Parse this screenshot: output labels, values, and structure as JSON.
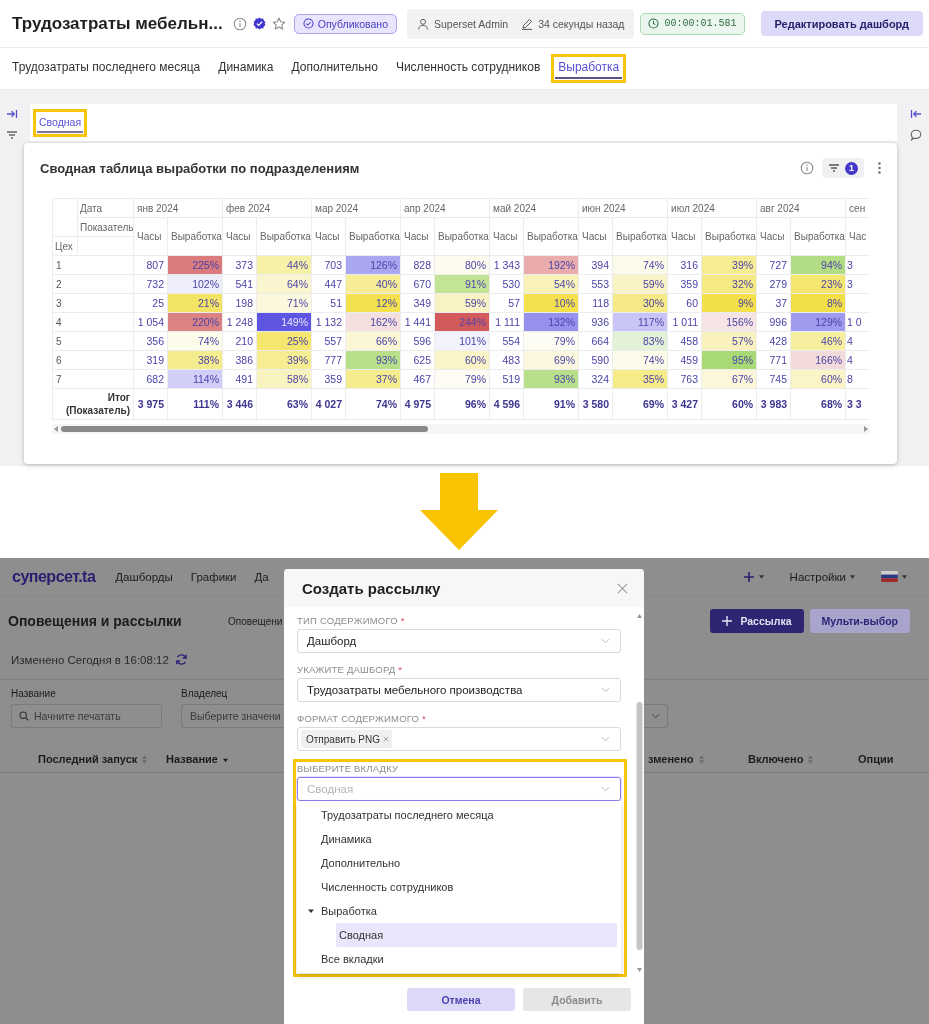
{
  "dashboard_screen": {
    "header": {
      "title": "Трудозатраты мебельн...",
      "favorite": false,
      "status": "Опубликовано",
      "owner": "Superset Admin",
      "modified": "34 секунды назад",
      "timer": "00:00:01.581",
      "edit_button": "Редактировать дашборд"
    },
    "tabs": [
      {
        "label": "Трудозатраты последнего месяца",
        "selected": false,
        "highlighted": false
      },
      {
        "label": "Динамика",
        "selected": false,
        "highlighted": false
      },
      {
        "label": "Дополнительно",
        "selected": false,
        "highlighted": false
      },
      {
        "label": "Численность сотрудников",
        "selected": false,
        "highlighted": false
      },
      {
        "label": "Выработка",
        "selected": true,
        "highlighted": true
      }
    ],
    "subtabs": [
      {
        "label": "Сводная",
        "selected": true,
        "highlighted": true
      }
    ],
    "chart": {
      "title": "Сводная таблица выработки по подразделениям",
      "filter_count": "1",
      "pivot": {
        "column_field": "Дата",
        "measure_field": "Показатель",
        "row_field": "Цех",
        "months": [
          {
            "label": "янв 2024",
            "measures": [
              "Часы",
              "Выработка"
            ]
          },
          {
            "label": "фев 2024",
            "measures": [
              "Часы",
              "Выработка"
            ]
          },
          {
            "label": "мар 2024",
            "measures": [
              "Часы",
              "Выработка"
            ]
          },
          {
            "label": "апр 2024",
            "measures": [
              "Часы",
              "Выработка"
            ]
          },
          {
            "label": "май 2024",
            "measures": [
              "Часы",
              "Выработка"
            ]
          },
          {
            "label": "июн 2024",
            "measures": [
              "Часы",
              "Выработка"
            ]
          },
          {
            "label": "июл 2024",
            "measures": [
              "Часы",
              "Выработка"
            ]
          },
          {
            "label": "авг 2024",
            "measures": [
              "Часы",
              "Выработка"
            ]
          },
          {
            "label": "сен",
            "measures": [
              "Час"
            ]
          }
        ],
        "rows": [
          {
            "label": "1",
            "cells": [
              {
                "hours": "807",
                "output": "225%",
                "color": "#da7c7d"
              },
              {
                "hours": "373",
                "output": "44%",
                "color": "#f7f0a7"
              },
              {
                "hours": "703",
                "output": "126%",
                "color": "#aaa7f1"
              },
              {
                "hours": "828",
                "output": "80%",
                "color": "#fdfbee"
              },
              {
                "hours": "1 343",
                "output": "192%",
                "color": "#e9abac"
              },
              {
                "hours": "394",
                "output": "74%",
                "color": "#fcfae8"
              },
              {
                "hours": "316",
                "output": "39%",
                "color": "#f6ec92"
              },
              {
                "hours": "727",
                "output": "94%",
                "color": "#b3dd84"
              },
              {
                "hours": "3"
              }
            ]
          },
          {
            "label": "2",
            "cells": [
              {
                "hours": "732",
                "output": "102%",
                "color": "#eeeefb"
              },
              {
                "hours": "541",
                "output": "64%",
                "color": "#faf5cf"
              },
              {
                "hours": "447",
                "output": "40%",
                "color": "#f6ed96"
              },
              {
                "hours": "670",
                "output": "91%",
                "color": "#c3e497"
              },
              {
                "hours": "530",
                "output": "54%",
                "color": "#f8f2b8"
              },
              {
                "hours": "553",
                "output": "59%",
                "color": "#f9f3c3"
              },
              {
                "hours": "359",
                "output": "32%",
                "color": "#f5e983"
              },
              {
                "hours": "279",
                "output": "23%",
                "color": "#f4e66f"
              },
              {
                "hours": "3"
              }
            ]
          },
          {
            "label": "3",
            "cells": [
              {
                "hours": "25",
                "output": "21%",
                "color": "#f4e465"
              },
              {
                "hours": "198",
                "output": "71%",
                "color": "#fcf8de"
              },
              {
                "hours": "51",
                "output": "12%",
                "color": "#f3e150"
              },
              {
                "hours": "349",
                "output": "59%",
                "color": "#f9f3c3"
              },
              {
                "hours": "57",
                "output": "10%",
                "color": "#f3e04c"
              },
              {
                "hours": "118",
                "output": "30%",
                "color": "#f5ea86"
              },
              {
                "hours": "60",
                "output": "9%",
                "color": "#f3df49"
              },
              {
                "hours": "37",
                "output": "8%",
                "color": "#f3df47"
              }
            ]
          },
          {
            "label": "4",
            "cells": [
              {
                "hours": "1 054",
                "output": "220%",
                "color": "#db8384"
              },
              {
                "hours": "1 248",
                "output": "149%",
                "color": "#5e56e0"
              },
              {
                "hours": "1 132",
                "output": "162%",
                "color": "#f4dfdf"
              },
              {
                "hours": "1 441",
                "output": "244%",
                "color": "#d45b5b"
              },
              {
                "hours": "1 111",
                "output": "132%",
                "color": "#9591ec"
              },
              {
                "hours": "936",
                "output": "117%",
                "color": "#c8c5f6"
              },
              {
                "hours": "1 011",
                "output": "156%",
                "color": "#f6e4e4"
              },
              {
                "hours": "996",
                "output": "129%",
                "color": "#9f9bee"
              },
              {
                "hours": "1 0"
              }
            ]
          },
          {
            "label": "5",
            "cells": [
              {
                "hours": "356",
                "output": "74%",
                "color": "#fdfbea"
              },
              {
                "hours": "210",
                "output": "25%",
                "color": "#f4e66f"
              },
              {
                "hours": "557",
                "output": "66%",
                "color": "#fbf6d4"
              },
              {
                "hours": "596",
                "output": "101%",
                "color": "#f2f2fc"
              },
              {
                "hours": "554",
                "output": "79%",
                "color": "#fefdf4"
              },
              {
                "hours": "664",
                "output": "83%",
                "color": "#e3f2d6"
              },
              {
                "hours": "458",
                "output": "57%",
                "color": "#f9f2be"
              },
              {
                "hours": "428",
                "output": "46%",
                "color": "#f7efa0"
              },
              {
                "hours": "4"
              }
            ]
          },
          {
            "label": "6",
            "cells": [
              {
                "hours": "319",
                "output": "38%",
                "color": "#f5ec8d"
              },
              {
                "hours": "386",
                "output": "39%",
                "color": "#f6ed92"
              },
              {
                "hours": "777",
                "output": "93%",
                "color": "#b8e08b"
              },
              {
                "hours": "625",
                "output": "60%",
                "color": "#faf4c6"
              },
              {
                "hours": "483",
                "output": "69%",
                "color": "#fcf8e0"
              },
              {
                "hours": "590",
                "output": "74%",
                "color": "#fdfbea"
              },
              {
                "hours": "459",
                "output": "95%",
                "color": "#a8d974"
              },
              {
                "hours": "771",
                "output": "166%",
                "color": "#f3dadb"
              },
              {
                "hours": "4"
              }
            ]
          },
          {
            "label": "7",
            "cells": [
              {
                "hours": "682",
                "output": "114%",
                "color": "#d1cef8"
              },
              {
                "hours": "491",
                "output": "58%",
                "color": "#f9f3c0"
              },
              {
                "hours": "359",
                "output": "37%",
                "color": "#f5ec8e"
              },
              {
                "hours": "467",
                "output": "79%",
                "color": "#fefcf2"
              },
              {
                "hours": "519",
                "output": "93%",
                "color": "#b8e08b"
              },
              {
                "hours": "324",
                "output": "35%",
                "color": "#f5eb88"
              },
              {
                "hours": "763",
                "output": "67%",
                "color": "#fcf7da"
              },
              {
                "hours": "745",
                "output": "60%",
                "color": "#faf4c6"
              },
              {
                "hours": "8"
              }
            ]
          }
        ],
        "total": {
          "label": "Итог (Показатель)",
          "cells": [
            {
              "hours": "3 975",
              "output": "111%"
            },
            {
              "hours": "3 446",
              "output": "63%"
            },
            {
              "hours": "4 027",
              "output": "74%"
            },
            {
              "hours": "4 975",
              "output": "96%"
            },
            {
              "hours": "4 596",
              "output": "91%"
            },
            {
              "hours": "3 580",
              "output": "69%"
            },
            {
              "hours": "3 427",
              "output": "60%"
            },
            {
              "hours": "3 983",
              "output": "68%"
            },
            {
              "hours": "3 3"
            }
          ]
        }
      }
    }
  },
  "mailing_screen": {
    "nav": {
      "logo": "суперсет.ta",
      "items": [
        "Дашборды",
        "Графики",
        "Да"
      ],
      "settings": "Настройки"
    },
    "title": "Оповещения и рассылки",
    "view_tab": "Оповещени",
    "actions": [
      {
        "label": "Рассылка",
        "kind": "primary"
      },
      {
        "label": "Мульти-выбор",
        "kind": "secondary"
      }
    ],
    "last_modified": "Изменено Сегодня в 16:08:12",
    "filters": [
      {
        "kind": "search",
        "label": "Название",
        "placeholder": "Начните печатать"
      },
      {
        "kind": "select",
        "label": "Владелец",
        "placeholder": "Выберите значени"
      }
    ],
    "columns_left": [
      {
        "label": "Последний запуск",
        "sortable": true,
        "sorted": false
      },
      {
        "label": "Название",
        "sortable": true,
        "sorted": true
      }
    ],
    "columns_right": [
      {
        "label": "зменено",
        "sortable": true,
        "sorted": false
      },
      {
        "label": "Включено",
        "sortable": true,
        "sorted": false
      },
      {
        "label": "Опции",
        "sortable": false
      }
    ],
    "modal": {
      "title": "Создать рассылку",
      "fields": [
        {
          "kind": "select",
          "label": "ТИП СОДЕРЖИМОГО",
          "required_mark": "*",
          "value": "Дашборд",
          "highlighted": false
        },
        {
          "kind": "select",
          "label": "УКАЖИТЕ ДАШБОРД",
          "required_mark": "*",
          "value": "Трудозатраты мебельного производства",
          "highlighted": false
        },
        {
          "kind": "tags",
          "label": "ФОРМАТ СОДЕРЖИМОГО",
          "required_mark": "*",
          "tags": [
            "Отправить PNG"
          ],
          "highlighted": false
        },
        {
          "kind": "tree_select",
          "label": "ВЫБЕРИТЕ ВКЛАДКУ",
          "value": "Сводная",
          "open": true,
          "highlighted": true,
          "options": [
            {
              "label": "Трудозатраты последнего месяца",
              "selected": false
            },
            {
              "label": "Динамика",
              "selected": false
            },
            {
              "label": "Дополнительно",
              "selected": false
            },
            {
              "label": "Численность сотрудников",
              "selected": false
            },
            {
              "label": "Выработка",
              "selected": false,
              "expanded": true,
              "children": [
                {
                  "label": "Сводная",
                  "selected": true
                }
              ]
            },
            {
              "label": "Все вкладки",
              "selected": false
            }
          ]
        }
      ],
      "buttons": [
        {
          "label": "Отмена",
          "kind": "cancel",
          "disabled": false
        },
        {
          "label": "Добавить",
          "kind": "submit",
          "disabled": true
        }
      ]
    }
  }
}
